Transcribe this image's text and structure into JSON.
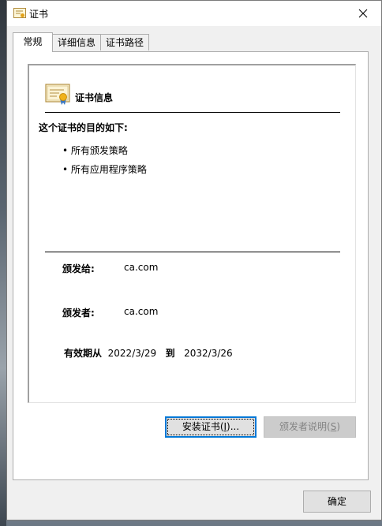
{
  "window": {
    "title": "证书"
  },
  "tabs": [
    {
      "label": "常规"
    },
    {
      "label": "详细信息"
    },
    {
      "label": "证书路径"
    }
  ],
  "general": {
    "info_title": "证书信息",
    "purpose_heading": "这个证书的目的如下:",
    "purposes": [
      "所有颁发策略",
      "所有应用程序策略"
    ],
    "issued_to_label": "颁发给:",
    "issued_to_value": "ca.com",
    "issued_by_label": "颁发者:",
    "issued_by_value": "ca.com",
    "valid_from_label": "有效期从",
    "valid_from": "2022/3/29",
    "valid_to_label": "到",
    "valid_to": "2032/3/26"
  },
  "buttons": {
    "install_text": "安装证书(",
    "install_key": "I",
    "install_suffix": ")...",
    "issuer_text": "颁发者说明(",
    "issuer_key": "S",
    "issuer_suffix": ")",
    "ok": "确定"
  },
  "colors": {
    "focus": "#0078d7",
    "panel": "#ffffff",
    "dialog": "#f0f0f0"
  }
}
